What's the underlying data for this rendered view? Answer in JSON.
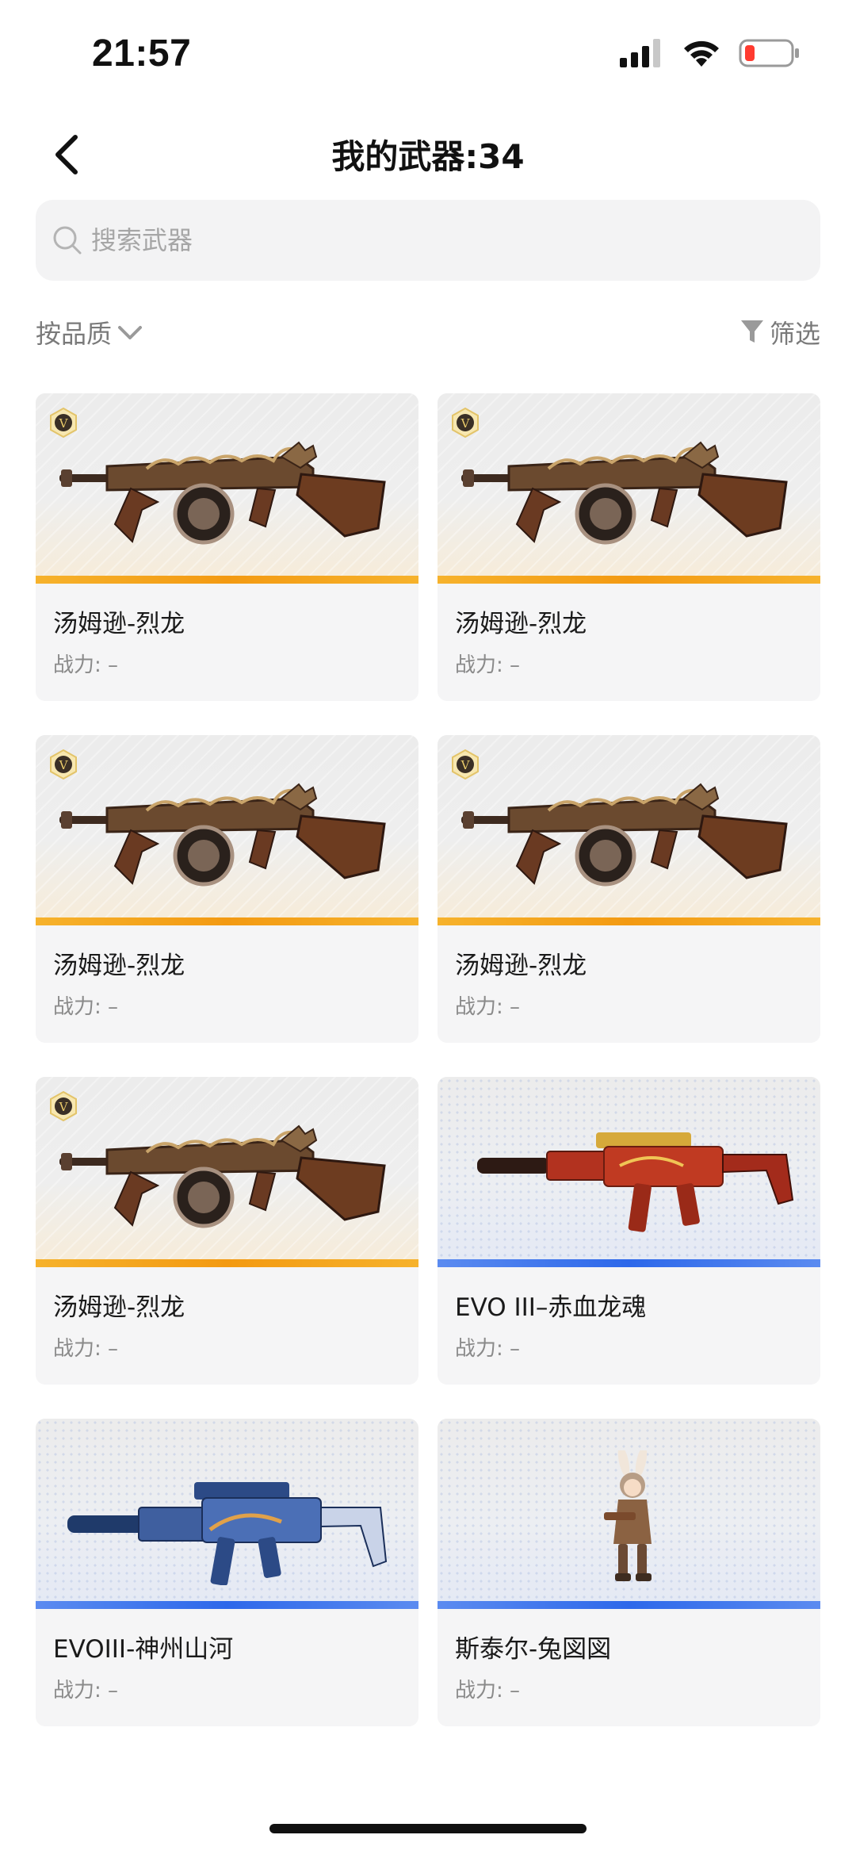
{
  "status_bar": {
    "time": "21:57"
  },
  "header": {
    "title": "我的武器:34"
  },
  "search": {
    "placeholder": "搜索武器"
  },
  "filters": {
    "sort_label": "按品质",
    "filter_label": "筛选"
  },
  "colors": {
    "gold": "#f39a12",
    "blue": "#2d68ea",
    "battery_low": "#ff3b30"
  },
  "weapons": [
    {
      "name": "汤姆逊-烈龙",
      "power": "战力: –",
      "quality": "gold",
      "badge": "V",
      "art": "thompson-gun-icon"
    },
    {
      "name": "汤姆逊-烈龙",
      "power": "战力: –",
      "quality": "gold",
      "badge": "V",
      "art": "thompson-gun-icon"
    },
    {
      "name": "汤姆逊-烈龙",
      "power": "战力: –",
      "quality": "gold",
      "badge": "V",
      "art": "thompson-gun-icon"
    },
    {
      "name": "汤姆逊-烈龙",
      "power": "战力: –",
      "quality": "gold",
      "badge": "V",
      "art": "thompson-gun-icon"
    },
    {
      "name": "汤姆逊-烈龙",
      "power": "战力: –",
      "quality": "gold",
      "badge": "V",
      "art": "thompson-gun-icon"
    },
    {
      "name": "EVO III–赤血龙魂",
      "power": "战力: –",
      "quality": "blue",
      "art": "red-smg-icon"
    },
    {
      "name": "EVOIII-神州山河",
      "power": "战力: –",
      "quality": "blue",
      "art": "blue-smg-icon"
    },
    {
      "name": "斯泰尔-兔図図",
      "power": "战力: –",
      "quality": "blue",
      "art": "bunny-character-icon"
    }
  ]
}
